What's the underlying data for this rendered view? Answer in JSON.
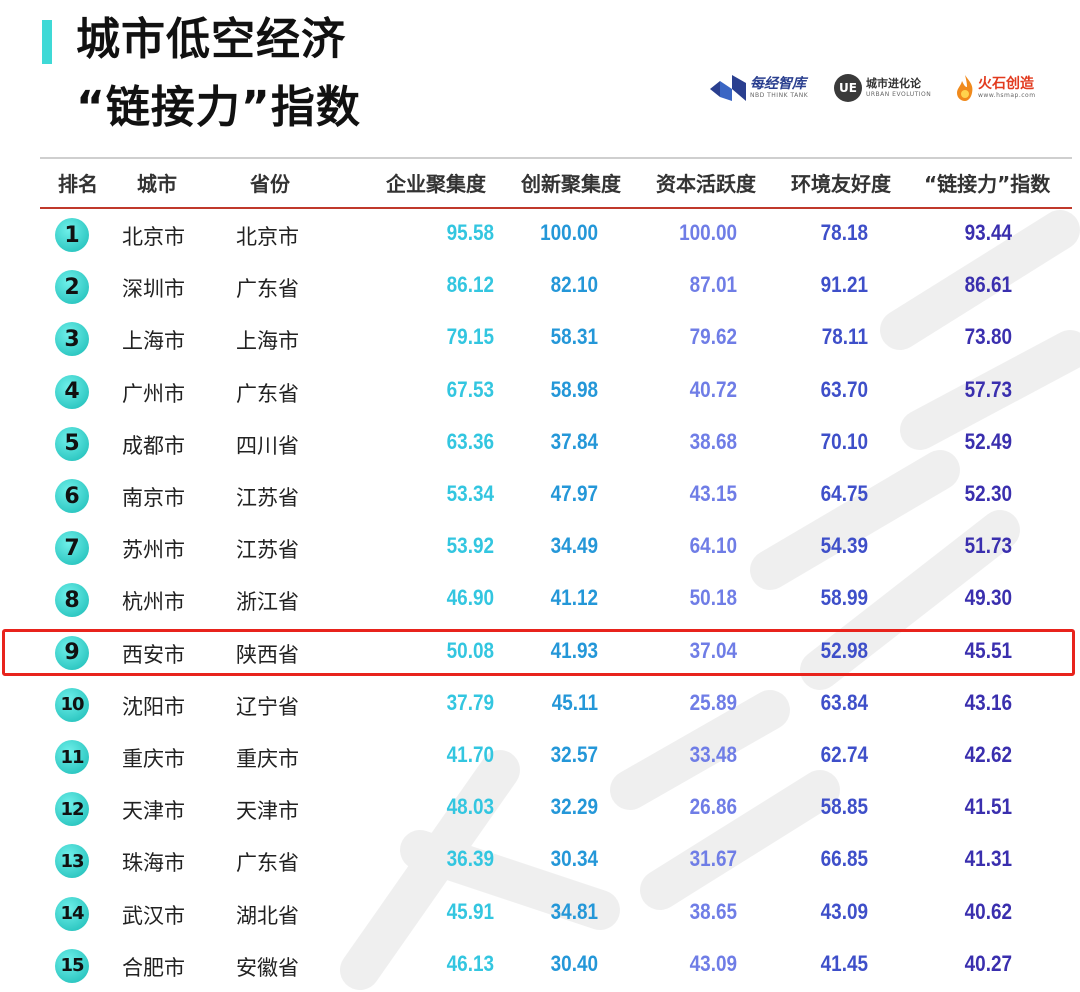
{
  "title": {
    "line1": "城市低空经济",
    "line2": "“链接力”指数"
  },
  "logos": [
    {
      "name": "每经智库",
      "sub": "NBD THINK TANK",
      "icon": "nbd-logo-icon"
    },
    {
      "name": "城市进化论",
      "sub": "URBAN EVOLUTION",
      "icon": "ue-logo-icon",
      "mark": "UE"
    },
    {
      "name": "火石创造",
      "sub": "www.hsmap.com",
      "icon": "flame-logo-icon"
    }
  ],
  "headers": [
    "排名",
    "城市",
    "省份",
    "企业聚集度",
    "创新聚集度",
    "资本活跃度",
    "环境友好度",
    "“链接力”指数"
  ],
  "rows": [
    [
      "1",
      "北京市",
      "北京市",
      "95.58",
      "100.00",
      "100.00",
      "78.18",
      "93.44"
    ],
    [
      "2",
      "深圳市",
      "广东省",
      "86.12",
      "82.10",
      "87.01",
      "91.21",
      "86.61"
    ],
    [
      "3",
      "上海市",
      "上海市",
      "79.15",
      "58.31",
      "79.62",
      "78.11",
      "73.80"
    ],
    [
      "4",
      "广州市",
      "广东省",
      "67.53",
      "58.98",
      "40.72",
      "63.70",
      "57.73"
    ],
    [
      "5",
      "成都市",
      "四川省",
      "63.36",
      "37.84",
      "38.68",
      "70.10",
      "52.49"
    ],
    [
      "6",
      "南京市",
      "江苏省",
      "53.34",
      "47.97",
      "43.15",
      "64.75",
      "52.30"
    ],
    [
      "7",
      "苏州市",
      "江苏省",
      "53.92",
      "34.49",
      "64.10",
      "54.39",
      "51.73"
    ],
    [
      "8",
      "杭州市",
      "浙江省",
      "46.90",
      "41.12",
      "50.18",
      "58.99",
      "49.30"
    ],
    [
      "9",
      "西安市",
      "陕西省",
      "50.08",
      "41.93",
      "37.04",
      "52.98",
      "45.51"
    ],
    [
      "10",
      "沈阳市",
      "辽宁省",
      "37.79",
      "45.11",
      "25.89",
      "63.84",
      "43.16"
    ],
    [
      "11",
      "重庆市",
      "重庆市",
      "41.70",
      "32.57",
      "33.48",
      "62.74",
      "42.62"
    ],
    [
      "12",
      "天津市",
      "天津市",
      "48.03",
      "32.29",
      "26.86",
      "58.85",
      "41.51"
    ],
    [
      "13",
      "珠海市",
      "广东省",
      "36.39",
      "30.34",
      "31.67",
      "66.85",
      "41.31"
    ],
    [
      "14",
      "武汉市",
      "湖北省",
      "45.91",
      "34.81",
      "38.65",
      "43.09",
      "40.62"
    ],
    [
      "15",
      "合肥市",
      "安徽省",
      "46.13",
      "30.40",
      "43.09",
      "41.45",
      "40.27"
    ]
  ],
  "highlighted_rank": "9",
  "colors": {
    "accent": "#3fd9d6",
    "header_rule": "#c0392b",
    "highlight_border": "#e8231c",
    "col_enterprise": "#33c6e0",
    "col_innovation": "#2497d8",
    "col_capital": "#6f7de6",
    "col_environment": "#3e4fc9",
    "col_index": "#3a2fae"
  }
}
